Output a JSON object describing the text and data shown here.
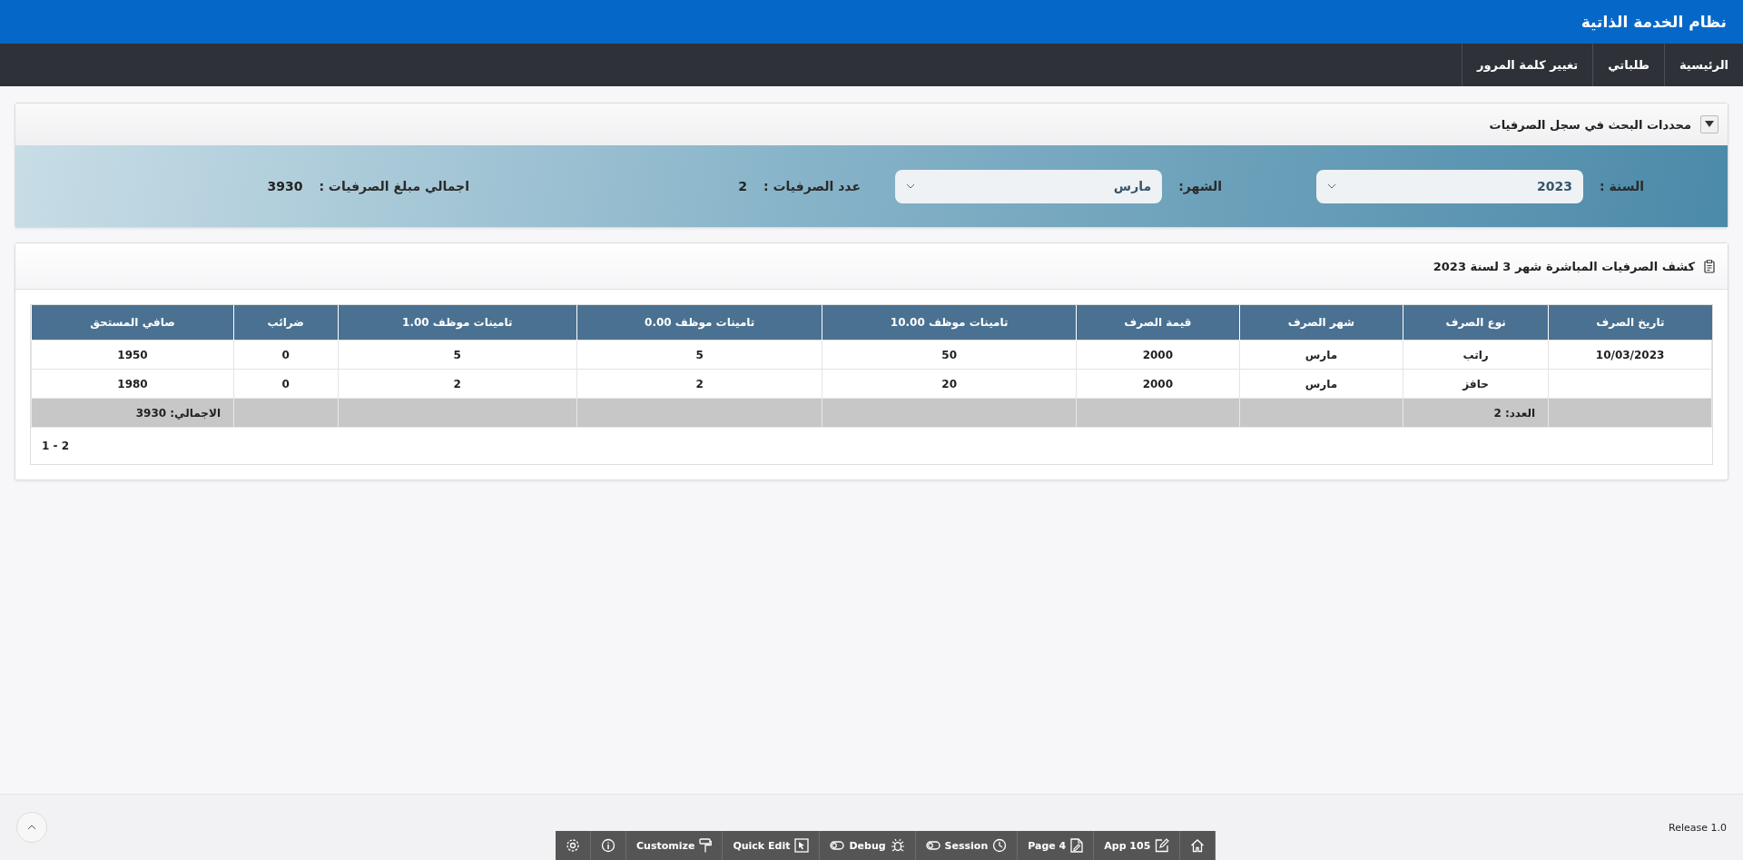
{
  "app": {
    "title": "نظام الخدمة الذاتية"
  },
  "nav": [
    {
      "label": "الرئيسية"
    },
    {
      "label": "طلباتي"
    },
    {
      "label": "تغيير كلمة المرور"
    }
  ],
  "search_region": {
    "title": "محددات البحث في سجل الصرفيات",
    "expanded": true,
    "year": {
      "label": "السنة :",
      "value": "2023"
    },
    "month": {
      "label": "الشهر:",
      "value": "مارس"
    },
    "count": {
      "label": "عدد الصرفيات :",
      "value": "2"
    },
    "total": {
      "label": "اجمالي مبلغ الصرفيات :",
      "value": "3930"
    }
  },
  "report": {
    "title": "كشف الصرفيات المباشرة شهر 3 لسنة 2023",
    "columns": [
      "تاريخ الصرف",
      "نوع الصرف",
      "شهر الصرف",
      "قيمة الصرف",
      "تامينات موظف 10.00",
      "تامينات موظف 0.00",
      "تامينات موظف 1.00",
      "ضرائب",
      "صافي المستحق"
    ],
    "rows": [
      [
        "10/03/2023",
        "راتب",
        "مارس",
        "2000",
        "50",
        "5",
        "5",
        "0",
        "1950"
      ],
      [
        "",
        "حافز",
        "مارس",
        "2000",
        "20",
        "2",
        "2",
        "0",
        "1980"
      ]
    ],
    "totals": {
      "count": "العدد: 2",
      "sum": "الاجمالي: 3930"
    },
    "pagination": "1 - 2"
  },
  "footer": {
    "release": "Release 1.0"
  },
  "dev_toolbar": [
    {
      "kind": "home"
    },
    {
      "kind": "app",
      "label": "App 105"
    },
    {
      "kind": "page",
      "label": "Page 4"
    },
    {
      "kind": "session",
      "label": "Session"
    },
    {
      "kind": "debug",
      "label": "Debug"
    },
    {
      "kind": "quick_edit",
      "label": "Quick Edit"
    },
    {
      "kind": "customize",
      "label": "Customize"
    },
    {
      "kind": "info"
    },
    {
      "kind": "settings"
    }
  ]
}
